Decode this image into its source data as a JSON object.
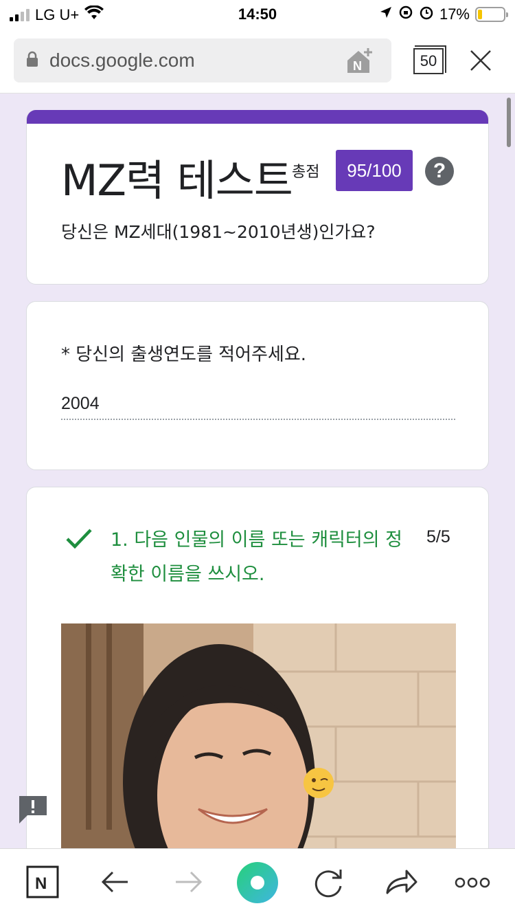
{
  "status_bar": {
    "carrier": "LG U+",
    "time": "14:50",
    "battery_percent": "17%",
    "battery_level": 0.17
  },
  "browser": {
    "url": "docs.google.com",
    "tab_count": "50",
    "icons": {
      "lock": "lock-icon",
      "home": "naver-home-icon",
      "tabs": "tabs-icon",
      "close": "close-icon"
    }
  },
  "form": {
    "title": "MZ력 테스트",
    "score_label": "총점",
    "score": "95/100",
    "help": "?",
    "description": "당신은 MZ세대(1981~2010년생)인가요?",
    "accent_color": "#673ab7"
  },
  "questions": [
    {
      "label": "* 당신의 출생연도를 적어주세요.",
      "answer": "2004"
    },
    {
      "text": "1. 다음 인물의 이름 또는 캐릭터의 정확한 이름을 쓰시오.",
      "points": "5/5",
      "status": "correct",
      "status_color": "#1e8e3e"
    }
  ],
  "toolbar": {
    "items": [
      "naver-icon",
      "back-icon",
      "forward-icon",
      "green-dot-icon",
      "refresh-icon",
      "share-icon",
      "more-icon"
    ]
  }
}
